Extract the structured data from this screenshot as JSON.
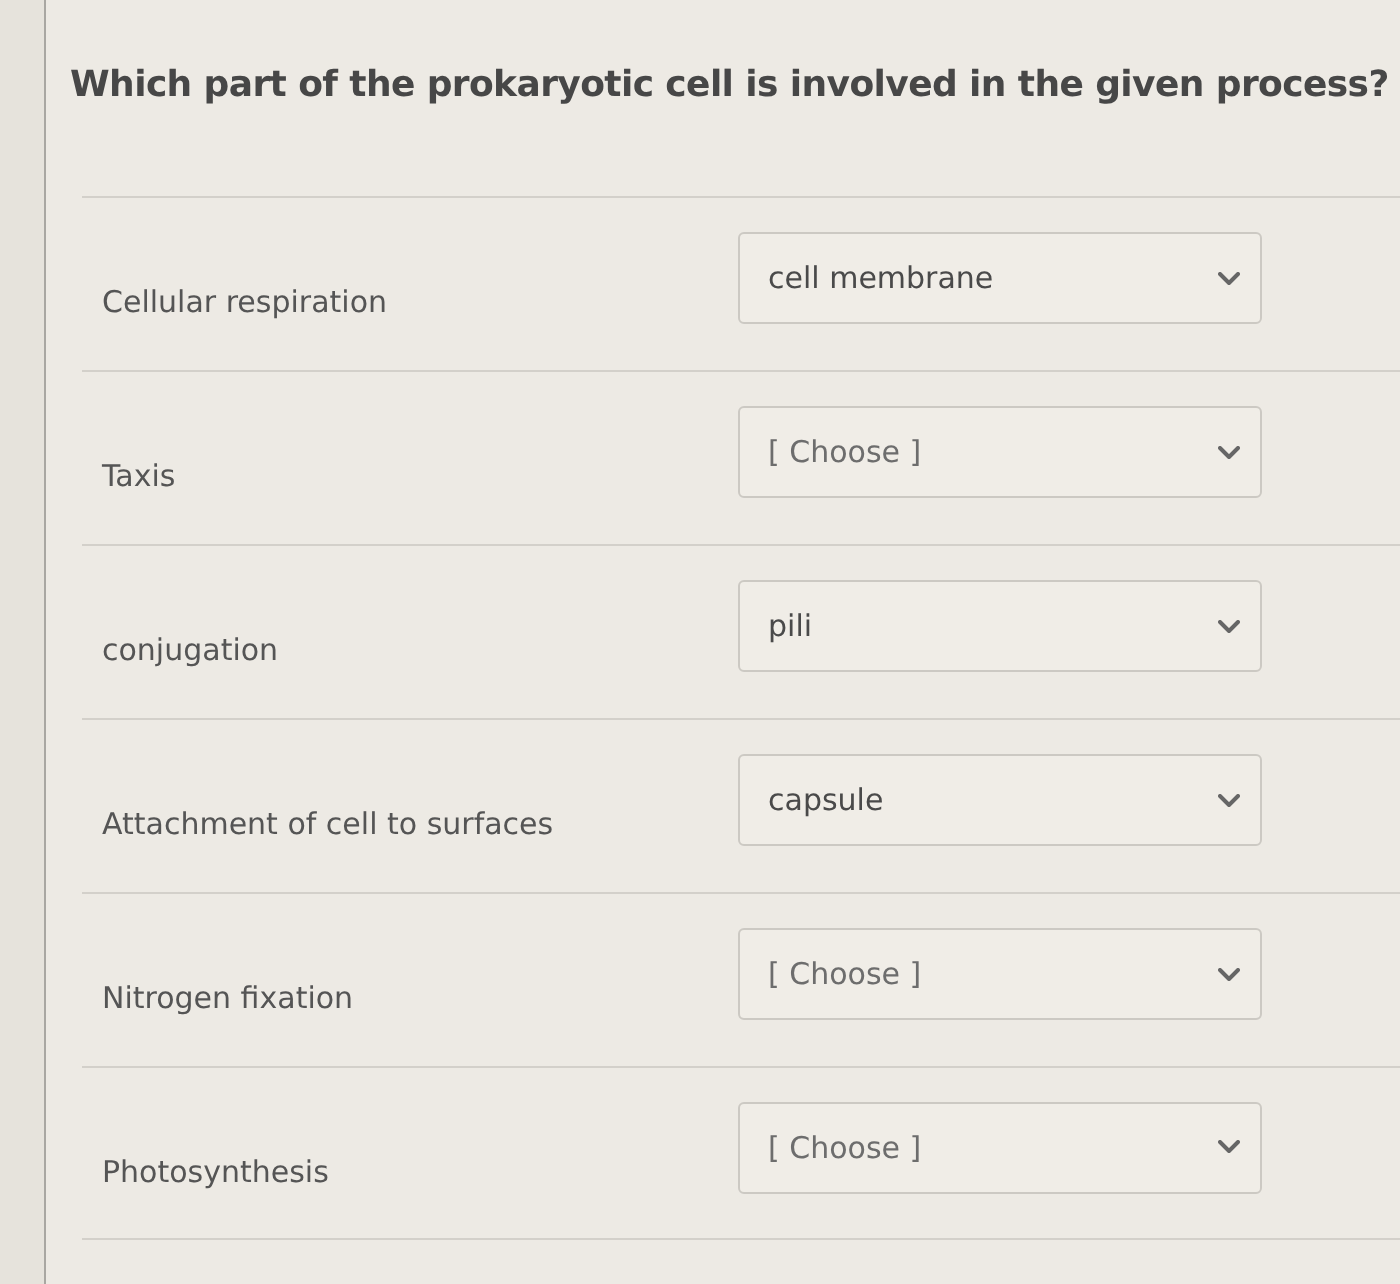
{
  "question": {
    "title": "Which part of the prokaryotic cell is involved in the given process?"
  },
  "rows": [
    {
      "prompt": "Cellular respiration",
      "answer": "cell membrane"
    },
    {
      "prompt": "Taxis",
      "placeholder": "[ Choose ]"
    },
    {
      "prompt": "conjugation",
      "answer": "pili"
    },
    {
      "prompt": "Attachment of cell to surfaces",
      "answer": "capsule"
    },
    {
      "prompt": "Nitrogen fixation",
      "placeholder": "[ Choose ]"
    },
    {
      "prompt": "Photosynthesis",
      "placeholder": "[ Choose ]"
    }
  ]
}
